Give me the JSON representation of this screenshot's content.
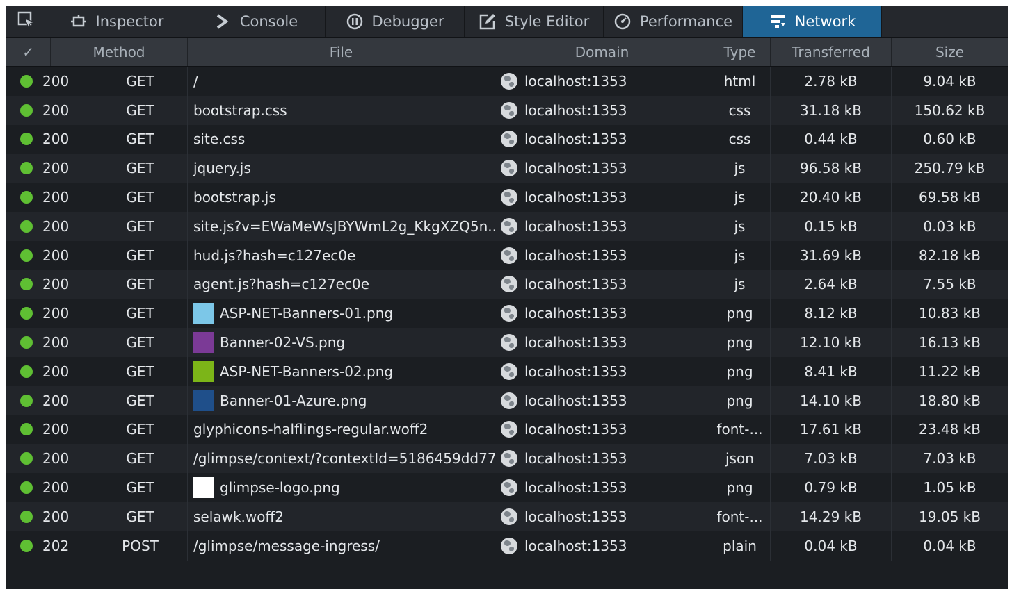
{
  "toolbar": {
    "tabs": [
      {
        "label": "Inspector",
        "icon": "inspector-box-icon"
      },
      {
        "label": "Console",
        "icon": "console-chevron-icon"
      },
      {
        "label": "Debugger",
        "icon": "debugger-pause-icon"
      },
      {
        "label": "Style Editor",
        "icon": "style-editor-pencil-icon"
      },
      {
        "label": "Performance",
        "icon": "performance-gauge-icon"
      },
      {
        "label": "Network",
        "icon": "network-icon",
        "active": true
      }
    ]
  },
  "columns": {
    "status": "✓",
    "method": "Method",
    "file": "File",
    "domain": "Domain",
    "type": "Type",
    "transferred": "Transferred",
    "size": "Size"
  },
  "colors": {
    "status_ok": "#5fbf33",
    "active_tab": "#1f6596"
  },
  "requests": [
    {
      "status": "200",
      "method": "GET",
      "file": "/",
      "domain": "localhost:1353",
      "type": "html",
      "transferred": "2.78 kB",
      "size": "9.04 kB"
    },
    {
      "status": "200",
      "method": "GET",
      "file": "bootstrap.css",
      "domain": "localhost:1353",
      "type": "css",
      "transferred": "31.18 kB",
      "size": "150.62 kB"
    },
    {
      "status": "200",
      "method": "GET",
      "file": "site.css",
      "domain": "localhost:1353",
      "type": "css",
      "transferred": "0.44 kB",
      "size": "0.60 kB"
    },
    {
      "status": "200",
      "method": "GET",
      "file": "jquery.js",
      "domain": "localhost:1353",
      "type": "js",
      "transferred": "96.58 kB",
      "size": "250.79 kB"
    },
    {
      "status": "200",
      "method": "GET",
      "file": "bootstrap.js",
      "domain": "localhost:1353",
      "type": "js",
      "transferred": "20.40 kB",
      "size": "69.58 kB"
    },
    {
      "status": "200",
      "method": "GET",
      "file": "site.js?v=EWaMeWsJBYWmL2g_KkgXZQ5n...",
      "domain": "localhost:1353",
      "type": "js",
      "transferred": "0.15 kB",
      "size": "0.03 kB"
    },
    {
      "status": "200",
      "method": "GET",
      "file": "hud.js?hash=c127ec0e",
      "domain": "localhost:1353",
      "type": "js",
      "transferred": "31.69 kB",
      "size": "82.18 kB"
    },
    {
      "status": "200",
      "method": "GET",
      "file": "agent.js?hash=c127ec0e",
      "domain": "localhost:1353",
      "type": "js",
      "transferred": "2.64 kB",
      "size": "7.55 kB"
    },
    {
      "status": "200",
      "method": "GET",
      "file": "ASP-NET-Banners-01.png",
      "thumb": "#7cc7e8",
      "domain": "localhost:1353",
      "type": "png",
      "transferred": "8.12 kB",
      "size": "10.83 kB"
    },
    {
      "status": "200",
      "method": "GET",
      "file": "Banner-02-VS.png",
      "thumb": "#7b3a96",
      "domain": "localhost:1353",
      "type": "png",
      "transferred": "12.10 kB",
      "size": "16.13 kB"
    },
    {
      "status": "200",
      "method": "GET",
      "file": "ASP-NET-Banners-02.png",
      "thumb": "#7cb518",
      "domain": "localhost:1353",
      "type": "png",
      "transferred": "8.41 kB",
      "size": "11.22 kB"
    },
    {
      "status": "200",
      "method": "GET",
      "file": "Banner-01-Azure.png",
      "thumb": "#1f4f8a",
      "domain": "localhost:1353",
      "type": "png",
      "transferred": "14.10 kB",
      "size": "18.80 kB"
    },
    {
      "status": "200",
      "method": "GET",
      "file": "glyphicons-halflings-regular.woff2",
      "domain": "localhost:1353",
      "type": "font-...",
      "transferred": "17.61 kB",
      "size": "23.48 kB"
    },
    {
      "status": "200",
      "method": "GET",
      "file": "/glimpse/context/?contextId=5186459dd77...",
      "domain": "localhost:1353",
      "type": "json",
      "transferred": "7.03 kB",
      "size": "7.03 kB"
    },
    {
      "status": "200",
      "method": "GET",
      "file": "glimpse-logo.png",
      "thumb": "#ffffff",
      "domain": "localhost:1353",
      "type": "png",
      "transferred": "0.79 kB",
      "size": "1.05 kB"
    },
    {
      "status": "200",
      "method": "GET",
      "file": "selawk.woff2",
      "domain": "localhost:1353",
      "type": "font-...",
      "transferred": "14.29 kB",
      "size": "19.05 kB"
    },
    {
      "status": "202",
      "method": "POST",
      "file": "/glimpse/message-ingress/",
      "domain": "localhost:1353",
      "type": "plain",
      "transferred": "0.04 kB",
      "size": "0.04 kB"
    }
  ]
}
